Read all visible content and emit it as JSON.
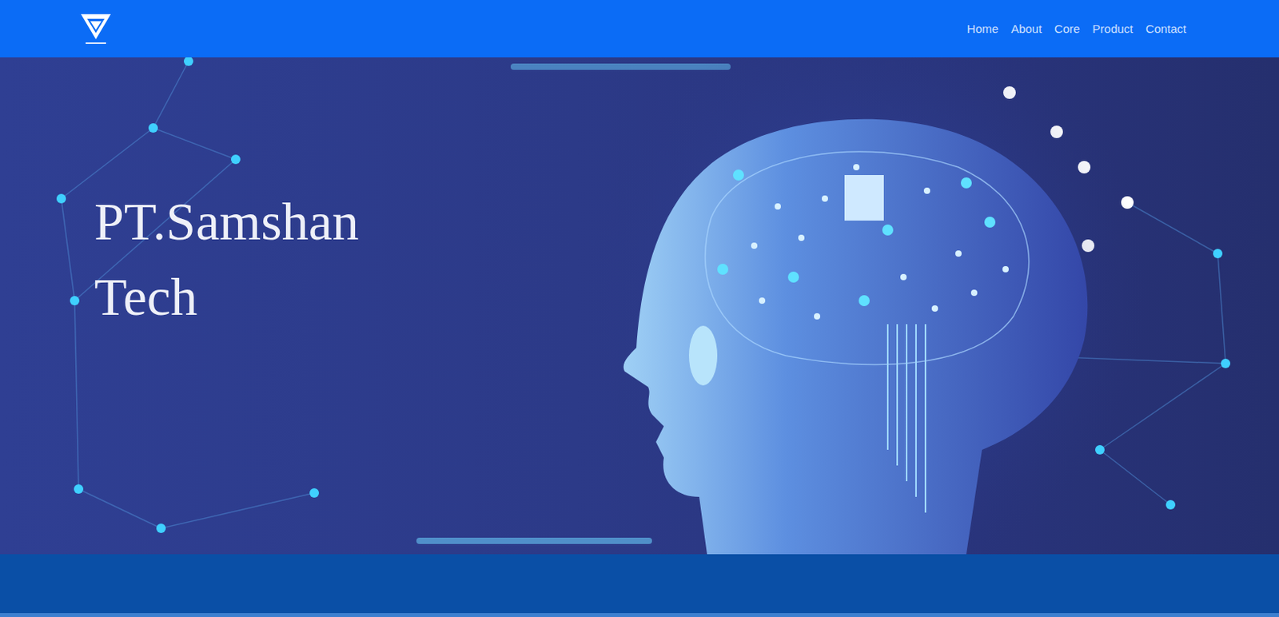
{
  "nav": {
    "links": [
      {
        "label": "Home"
      },
      {
        "label": "About"
      },
      {
        "label": "Core"
      },
      {
        "label": "Product"
      },
      {
        "label": "Contact"
      }
    ]
  },
  "hero": {
    "title_lines": [
      "PT.Samshan",
      "Tech"
    ]
  }
}
